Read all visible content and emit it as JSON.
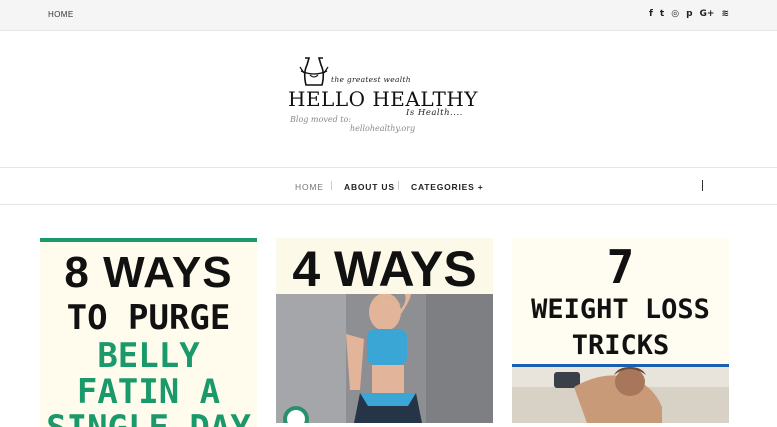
{
  "topbar": {
    "home_label": "HOME",
    "social_icons": [
      {
        "name": "facebook-icon",
        "glyph": "f"
      },
      {
        "name": "twitter-icon",
        "glyph": "t"
      },
      {
        "name": "instagram-icon",
        "glyph": "◎"
      },
      {
        "name": "pinterest-icon",
        "glyph": "p"
      },
      {
        "name": "google-plus-icon",
        "glyph": "G+"
      },
      {
        "name": "rss-icon",
        "glyph": "≋"
      }
    ]
  },
  "logo": {
    "tagline_top": "the greatest wealth",
    "title": "HELLO HEALTHY",
    "tagline_bottom": "Is Health....",
    "moved_note_1": "Blog moved to:",
    "moved_note_2": "hellohealthy.org"
  },
  "nav": {
    "items": [
      "HOME",
      "ABOUT US",
      "CATEGORIES +"
    ]
  },
  "cards": [
    {
      "line1": "8 WAYS",
      "line2": "TO PURGE",
      "line3": "BELLY",
      "line4": "FATIN A",
      "line5": "SINGLE DAY",
      "accent": "#1a9a6a"
    },
    {
      "line1": "4 WAYS"
    },
    {
      "line1": "7",
      "line2": "WEIGHT LOSS",
      "line3": "TRICKS",
      "accent": "#1a5fb0"
    }
  ]
}
